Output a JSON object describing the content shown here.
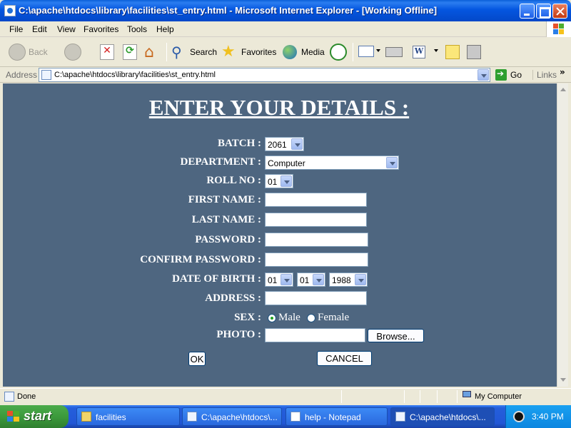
{
  "window": {
    "title": "C:\\apache\\htdocs\\library\\facilities\\st_entry.html - Microsoft Internet Explorer - [Working Offline]"
  },
  "menu": [
    "File",
    "Edit",
    "View",
    "Favorites",
    "Tools",
    "Help"
  ],
  "toolbar": {
    "back": "Back",
    "search": "Search",
    "favorites": "Favorites",
    "media": "Media"
  },
  "addressbar": {
    "label": "Address",
    "url": "C:\\apache\\htdocs\\library\\facilities\\st_entry.html",
    "go": "Go",
    "links": "Links",
    "links_more": "»"
  },
  "form": {
    "title": "ENTER YOUR DETAILS :",
    "batch_label": "BATCH :",
    "batch_value": "2061",
    "department_label": "DEPARTMENT :",
    "department_value": "Computer",
    "rollno_label": "ROLL NO :",
    "rollno_value": "01",
    "firstname_label": "FIRST NAME :",
    "lastname_label": "LAST NAME :",
    "password_label": "PASSWORD :",
    "confirm_label": "CONFIRM PASSWORD :",
    "dob_label": "DATE OF BIRTH :",
    "dob_day": "01",
    "dob_month": "01",
    "dob_year": "1988",
    "address_label": "ADDRESS :",
    "sex_label": "SEX :",
    "sex_male": "Male",
    "sex_female": "Female",
    "photo_label": "PHOTO :",
    "browse": "Browse...",
    "ok": "OK",
    "cancel": "CANCEL"
  },
  "statusbar": {
    "text": "Done",
    "zone": "My Computer"
  },
  "taskbar": {
    "start": "start",
    "tasks": [
      "facilities",
      "C:\\apache\\htdocs\\...",
      "help - Notepad",
      "C:\\apache\\htdocs\\..."
    ],
    "clock": "3:40 PM"
  }
}
